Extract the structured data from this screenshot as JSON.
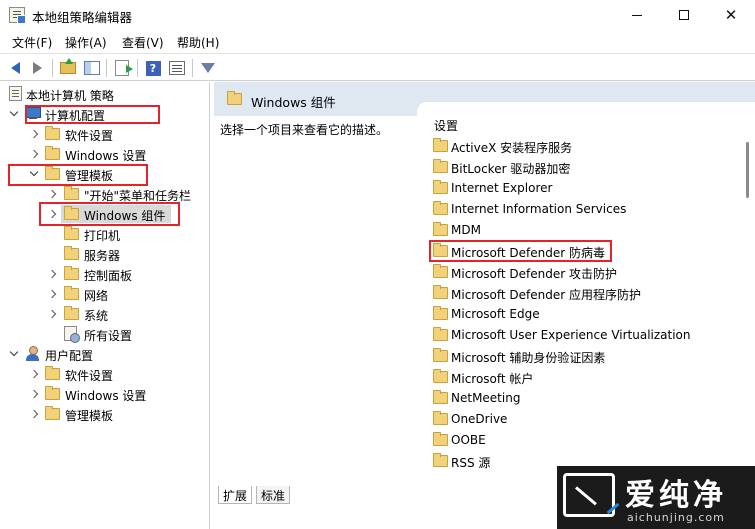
{
  "window": {
    "title": "本地组策略编辑器",
    "icon": "policy-editor-icon",
    "controls": {
      "minimize": "minimize-icon",
      "maximize": "maximize-icon",
      "close": "✕"
    }
  },
  "menu": {
    "file": "文件(F)",
    "action": "操作(A)",
    "view": "查看(V)",
    "help": "帮助(H)"
  },
  "toolbar": {
    "buttons": [
      "back-arrow-icon",
      "forward-arrow-icon",
      "up-folder-icon",
      "show-hide-tree-icon",
      "export-list-icon",
      "help-icon",
      "properties-icon",
      "filter-icon"
    ],
    "help_glyph": "?"
  },
  "tree": {
    "root": "本地计算机 策略",
    "computer_config": "计算机配置",
    "cc_software": "软件设置",
    "cc_windows_settings": "Windows 设置",
    "cc_admin_templates": "管理模板",
    "at_start_menu": "\"开始\"菜单和任务栏",
    "at_windows_components": "Windows 组件",
    "at_printers": "打印机",
    "at_server": "服务器",
    "at_control_panel": "控制面板",
    "at_network": "网络",
    "at_system": "系统",
    "at_all_settings": "所有设置",
    "user_config": "用户配置",
    "uc_software": "软件设置",
    "uc_windows_settings": "Windows 设置",
    "uc_admin_templates": "管理模板",
    "selected": "Windows 组件"
  },
  "details": {
    "header_title": "Windows 组件",
    "description": "选择一个项目来查看它的描述。",
    "column_header": "设置",
    "items": [
      "ActiveX 安装程序服务",
      "BitLocker 驱动器加密",
      "Internet Explorer",
      "Internet Information Services",
      "MDM",
      "Microsoft Defender 防病毒",
      "Microsoft Defender 攻击防护",
      "Microsoft Defender 应用程序防护",
      "Microsoft Edge",
      "Microsoft User Experience Virtualization",
      "Microsoft 辅助身份验证因素",
      "Microsoft 帐户",
      "NetMeeting",
      "OneDrive",
      "OOBE",
      "RSS 源"
    ],
    "highlighted_item": "Microsoft Defender 防病毒"
  },
  "tabs": {
    "expand": "扩展",
    "standard": "标准"
  },
  "watermark": {
    "brand": "爱纯净",
    "domain": "aichunjing.com"
  },
  "colors": {
    "highlight_box": "#e3242b",
    "header_band": "#dfe7f1",
    "selected_bg": "#d9d9d9"
  }
}
